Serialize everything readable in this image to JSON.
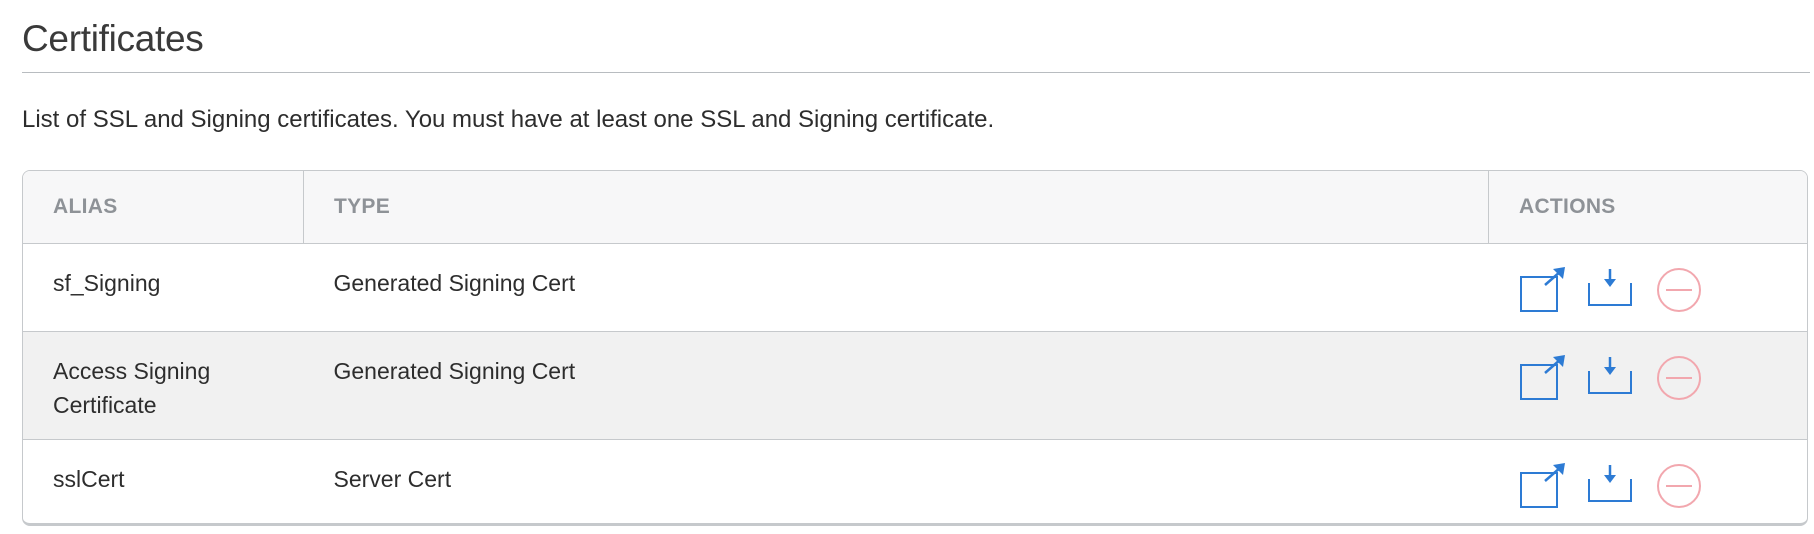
{
  "section": {
    "title": "Certificates",
    "description": "List of SSL and Signing certificates. You must have at least one SSL and Signing certificate."
  },
  "table": {
    "headers": {
      "alias": "ALIAS",
      "type": "TYPE",
      "actions": "ACTIONS"
    },
    "rows": [
      {
        "alias": "sf_Signing",
        "type": "Generated Signing Cert"
      },
      {
        "alias": "Access Signing Certificate",
        "type": "Generated Signing Cert"
      },
      {
        "alias": "sslCert",
        "type": "Server Cert"
      }
    ],
    "row_actions": [
      "export-icon",
      "download-icon",
      "remove-icon"
    ]
  },
  "colors": {
    "accent": "#2d7bd4",
    "delete": "#f2a7ae",
    "header_text": "#8e9297",
    "border": "#c6c9cc",
    "alt_row": "#f1f1f1"
  }
}
